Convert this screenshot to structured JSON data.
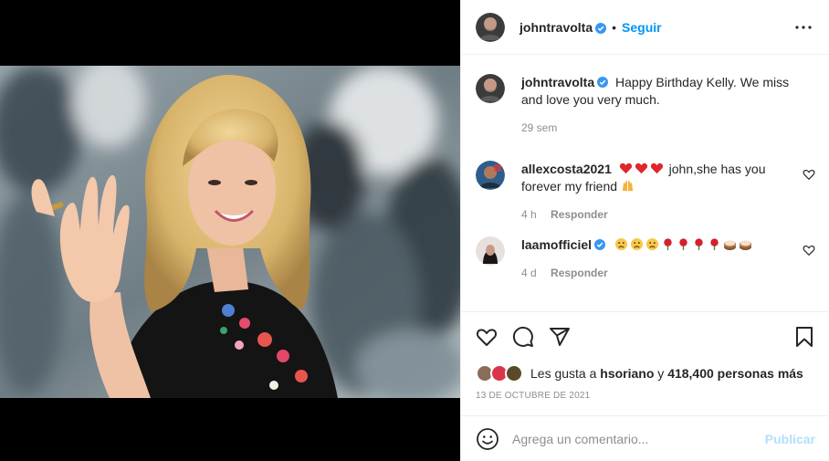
{
  "post": {
    "author": "johntravolta",
    "follow_label": "Seguir",
    "dot": "•",
    "caption": "Happy Birthday Kelly. We miss and love you very much.",
    "caption_age": "29 sem"
  },
  "comments": [
    {
      "user": "allexcosta2021",
      "text": "john,she has you forever my friend",
      "age": "4 h",
      "reply_label": "Responder"
    },
    {
      "user": "laamofficiel",
      "age": "4 d",
      "reply_label": "Responder"
    }
  ],
  "likes": {
    "prefix": "Les gusta a",
    "first_user": "hsoriano",
    "joiner": "y",
    "others": "418,400 personas más"
  },
  "date": "13 DE OCTUBRE DE 2021",
  "composer": {
    "placeholder": "Agrega un comentario...",
    "publish_label": "Publicar"
  },
  "colors": {
    "accent": "#0095f6",
    "publish_disabled": "#b2dffc",
    "verified": "#3897f0",
    "muted": "#8e8e8e"
  },
  "icons": [
    "verified-badge-icon",
    "more-options-icon",
    "heart-icon",
    "comment-icon",
    "share-icon",
    "bookmark-icon",
    "emoji-icon"
  ]
}
